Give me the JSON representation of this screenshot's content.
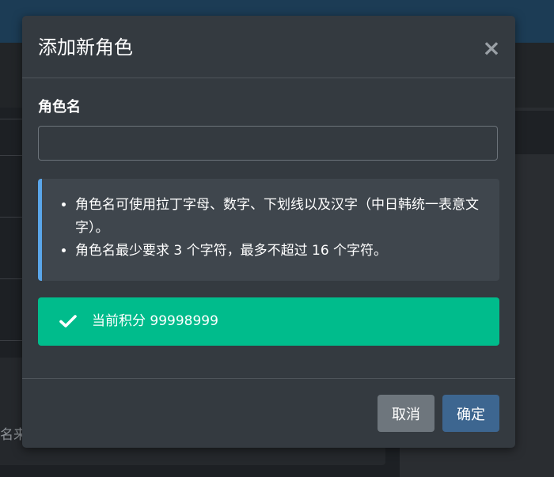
{
  "background": {
    "partial_text": "名来"
  },
  "modal": {
    "title": "添加新角色",
    "close_symbol": "×",
    "field_label": "角色名",
    "input_value": "",
    "input_placeholder": "",
    "info_items": [
      "角色名可使用拉丁字母、数字、下划线以及汉字（中日韩统一表意文字）。",
      "角色名最少要求 3 个字符，最多不超过 16 个字符。"
    ],
    "success_icon": "check-icon",
    "success_text": "当前积分 99998999",
    "cancel_label": "取消",
    "confirm_label": "确定"
  },
  "colors": {
    "modal_bg": "#343a40",
    "info_accent": "#5aa6ea",
    "success": "#00bc8c",
    "cancel": "#6e767d",
    "confirm": "#3d6690"
  }
}
